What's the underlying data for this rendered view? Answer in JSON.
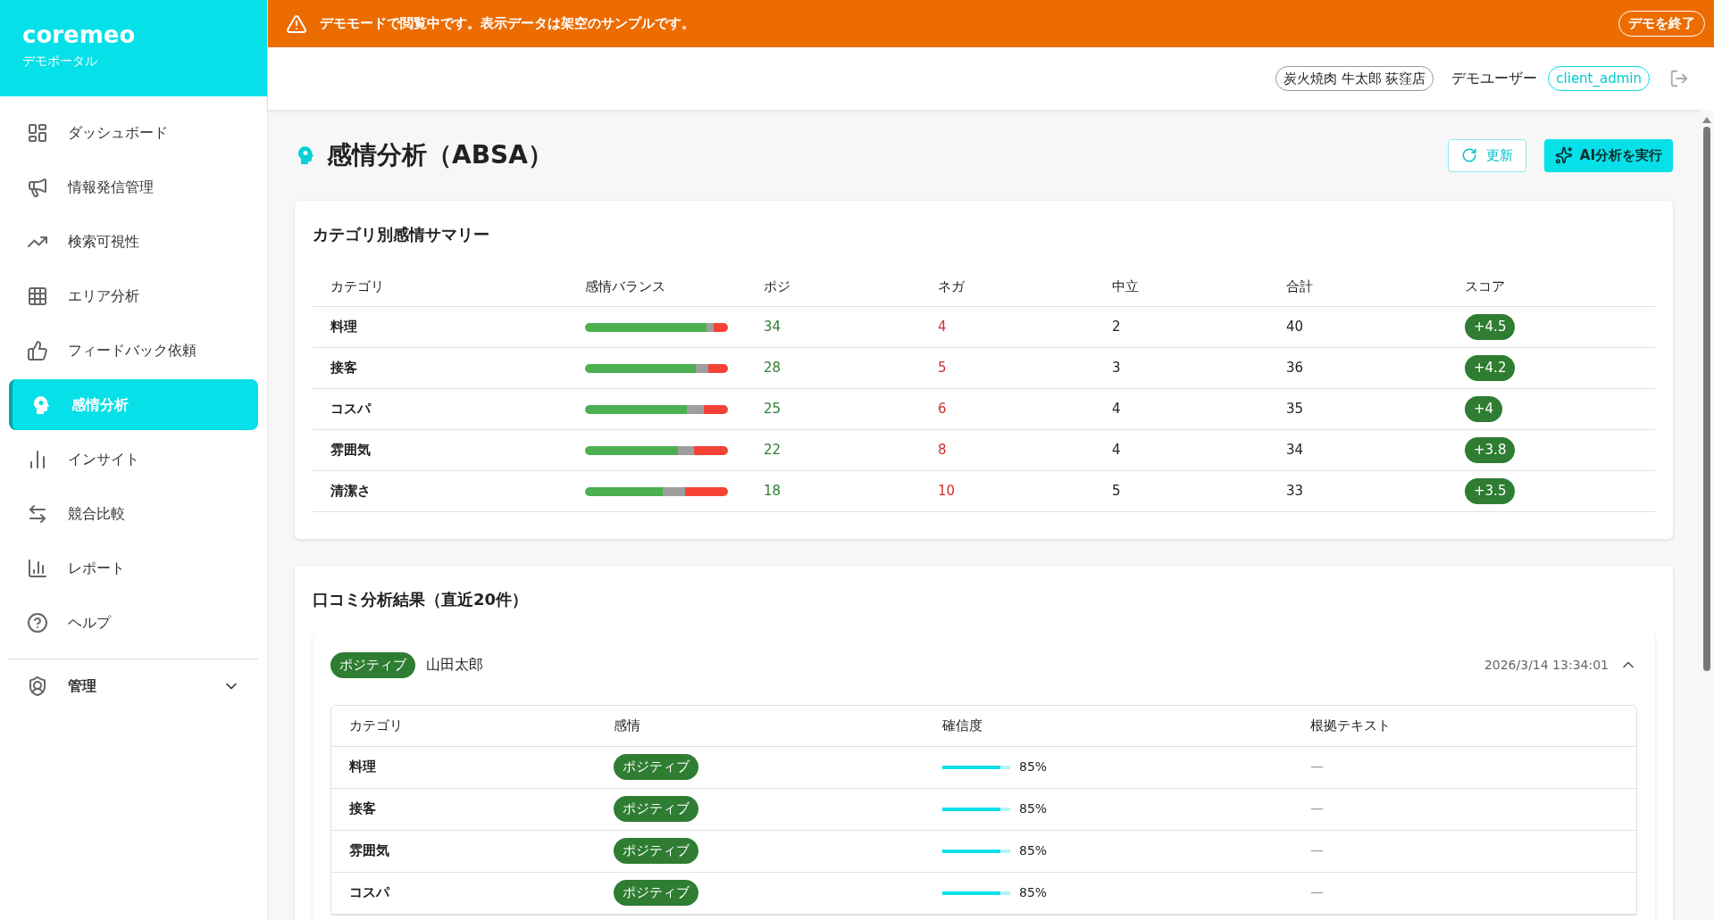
{
  "banner": {
    "text": "デモモードで閲覧中です。表示データは架空のサンプルです。",
    "exit_button": "デモを終了"
  },
  "brand": {
    "name": "coremeo",
    "subtitle": "デモポータル"
  },
  "sidebar": {
    "items": [
      {
        "label": "ダッシュボード",
        "selected": false
      },
      {
        "label": "情報発信管理",
        "selected": false
      },
      {
        "label": "検索可視性",
        "selected": false
      },
      {
        "label": "エリア分析",
        "selected": false
      },
      {
        "label": "フィードバック依頼",
        "selected": false
      },
      {
        "label": "感情分析",
        "selected": true
      },
      {
        "label": "インサイト",
        "selected": false
      },
      {
        "label": "競合比較",
        "selected": false
      },
      {
        "label": "レポート",
        "selected": false
      },
      {
        "label": "ヘルプ",
        "selected": false
      }
    ],
    "group": {
      "label": "管理",
      "expanded": false
    }
  },
  "topbar": {
    "store": "炭火焼肉 牛太郎 荻窪店",
    "user": "デモユーザー",
    "role": "client_admin"
  },
  "page": {
    "title": "感情分析（ABSA）",
    "refresh_button": "更新",
    "run_button": "AI分析を実行"
  },
  "summary": {
    "title": "カテゴリ別感情サマリー",
    "columns": [
      "カテゴリ",
      "感情バランス",
      "ポジ",
      "ネガ",
      "中立",
      "合計",
      "スコア"
    ],
    "rows": [
      {
        "category": "料理",
        "positive": "34",
        "negative": "4",
        "neutral": "2",
        "total": "40",
        "score": "+4.5"
      },
      {
        "category": "接客",
        "positive": "28",
        "negative": "5",
        "neutral": "3",
        "total": "36",
        "score": "+4.2"
      },
      {
        "category": "コスパ",
        "positive": "25",
        "negative": "6",
        "neutral": "4",
        "total": "35",
        "score": "+4"
      },
      {
        "category": "雰囲気",
        "positive": "22",
        "negative": "8",
        "neutral": "4",
        "total": "34",
        "score": "+3.8"
      },
      {
        "category": "清潔さ",
        "positive": "18",
        "negative": "10",
        "neutral": "5",
        "total": "33",
        "score": "+3.5"
      }
    ]
  },
  "reviews": {
    "title": "口コミ分析結果（直近20件）",
    "items": [
      {
        "sentiment": "ポジティブ",
        "kind": "positive",
        "author": "山田太郎",
        "date": "2026/3/14 13:34:01",
        "expanded": true,
        "columns": [
          "カテゴリ",
          "感情",
          "確信度",
          "根拠テキスト"
        ],
        "rows": [
          {
            "category": "料理",
            "sentiment": "ポジティブ",
            "kind": "positive",
            "level": 0.85,
            "reading": "85%",
            "evidence": "—"
          },
          {
            "category": "接客",
            "sentiment": "ポジティブ",
            "kind": "positive",
            "level": 0.85,
            "reading": "85%",
            "evidence": "—"
          },
          {
            "category": "雰囲気",
            "sentiment": "ポジティブ",
            "kind": "positive",
            "level": 0.85,
            "reading": "85%",
            "evidence": "—"
          },
          {
            "category": "コスパ",
            "sentiment": "ポジティブ",
            "kind": "positive",
            "level": 0.85,
            "reading": "85%",
            "evidence": "—"
          }
        ]
      }
    ]
  }
}
